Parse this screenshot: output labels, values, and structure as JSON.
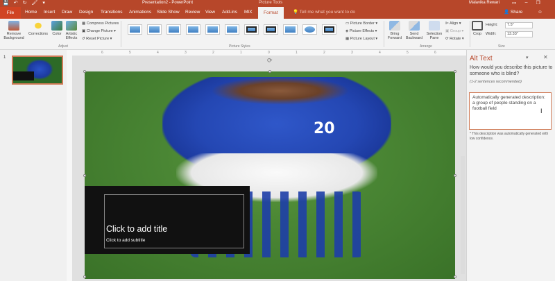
{
  "titlebar": {
    "document_title": "Presentation2 - PowerPoint",
    "context_tools": "Picture Tools",
    "user": "Malavika Rewari",
    "qat": [
      "💾",
      "↶",
      "↻",
      "🖌",
      "▾"
    ]
  },
  "tabs": {
    "file": "File",
    "items": [
      "Home",
      "Insert",
      "Draw",
      "Design",
      "Transitions",
      "Animations",
      "Slide Show",
      "Review",
      "View",
      "Add-ins",
      "MIX"
    ],
    "format": "Format",
    "tell_me": "Tell me what you want to do",
    "share": "Share"
  },
  "ribbon": {
    "remove_background": "Remove Background",
    "corrections": "Corrections",
    "color": "Color",
    "artistic_effects": "Artistic Effects",
    "compress": "Compress Pictures",
    "change": "Change Picture",
    "reset": "Reset Picture",
    "adjust_group": "Adjust",
    "styles_group": "Picture Styles",
    "picture_border": "Picture Border",
    "picture_effects": "Picture Effects",
    "picture_layout": "Picture Layout",
    "bring_forward": "Bring Forward",
    "send_backward": "Send Backward",
    "selection_pane": "Selection Pane",
    "align": "Align",
    "group": "Group",
    "rotate": "Rotate",
    "arrange_group": "Arrange",
    "crop": "Crop",
    "height_label": "Height:",
    "height_value": "7.5\"",
    "width_label": "Width:",
    "width_value": "13.33\"",
    "size_group": "Size"
  },
  "slides_pane": {
    "slide_number": "1"
  },
  "slide": {
    "jersey_number": "20",
    "title_placeholder": "Click to add title",
    "subtitle_placeholder": "Click to add subtitle"
  },
  "ruler": {
    "ticks": [
      "6",
      "5",
      "4",
      "3",
      "2",
      "1",
      "0",
      "1",
      "2",
      "3",
      "4",
      "5",
      "6"
    ]
  },
  "alt_text_pane": {
    "title": "Alt Text",
    "question": "How would you describe this picture to someone who is blind?",
    "hint": "(1-2 sentences recommended)",
    "description": "Automatically generated description: a group of people standing on a football field",
    "note": "* This description was automatically generated with low confidence."
  }
}
